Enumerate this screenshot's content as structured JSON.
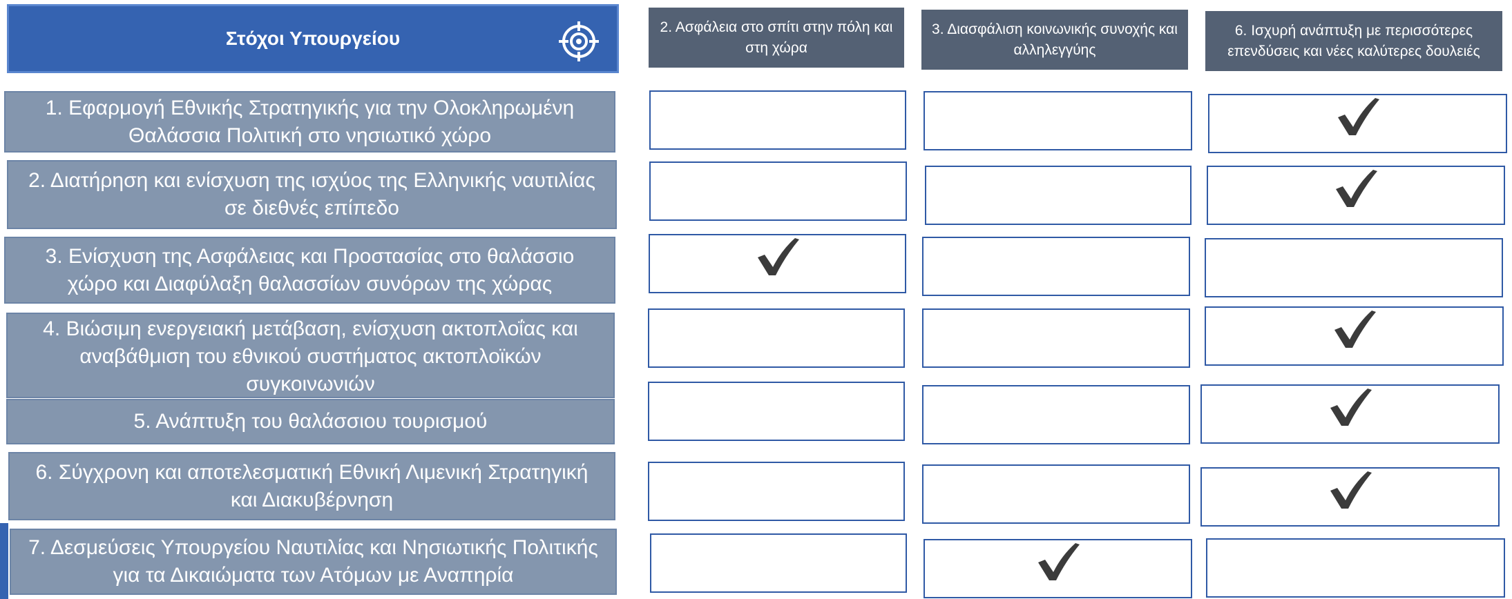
{
  "header": {
    "title": "Στόχοι Υπουργείου",
    "icon": "target-icon"
  },
  "columns": [
    "2. Ασφάλεια στο σπίτι στην πόλη και στη χώρα",
    "3. Διασφάλιση κοινωνικής συνοχής και αλληλεγγύης",
    "6. Ισχυρή ανάπτυξη με περισσότερες επενδύσεις και νέες  καλύτερες δουλειές"
  ],
  "rows": [
    {
      "goal": "1. Εφαρμογή Εθνικής Στρατηγικής για την Ολοκληρωμένη Θαλάσσια Πολιτική στο νησιωτικό χώρο",
      "checks": [
        false,
        false,
        true
      ]
    },
    {
      "goal": "2. Διατήρηση και ενίσχυση της ισχύος της Ελληνικής ναυτιλίας σε διεθνές επίπεδο",
      "checks": [
        false,
        false,
        true
      ]
    },
    {
      "goal": "3. Ενίσχυση της Ασφάλειας και Προστασίας στο θαλάσσιο χώρο και Διαφύλαξη θαλασσίων συνόρων της χώρας",
      "checks": [
        true,
        false,
        false
      ]
    },
    {
      "goal": "4. Βιώσιμη ενεργειακή μετάβαση, ενίσχυση ακτοπλοΐας και αναβάθμιση του εθνικού συστήματος ακτοπλοϊκών συγκοινωνιών",
      "checks": [
        false,
        false,
        true
      ]
    },
    {
      "goal": "5. Ανάπτυξη του θαλάσσιου τουρισμού",
      "checks": [
        false,
        false,
        true
      ]
    },
    {
      "goal": "6. Σύγχρονη και αποτελεσματική Εθνική Λιμενική Στρατηγική και Διακυβέρνηση",
      "checks": [
        false,
        false,
        true
      ]
    },
    {
      "goal": "7. Δεσμεύσεις Υπουργείου Ναυτιλίας και Νησιωτικής Πολιτικής για τα Δικαιώματα των Ατόμων με Αναπηρία",
      "checks": [
        false,
        true,
        false
      ]
    }
  ],
  "colors": {
    "header": "#3563b1",
    "column_header": "#546174",
    "goal_box": "#8496ae",
    "cell_border": "#2f59a5",
    "check": "#3b3b3b"
  }
}
